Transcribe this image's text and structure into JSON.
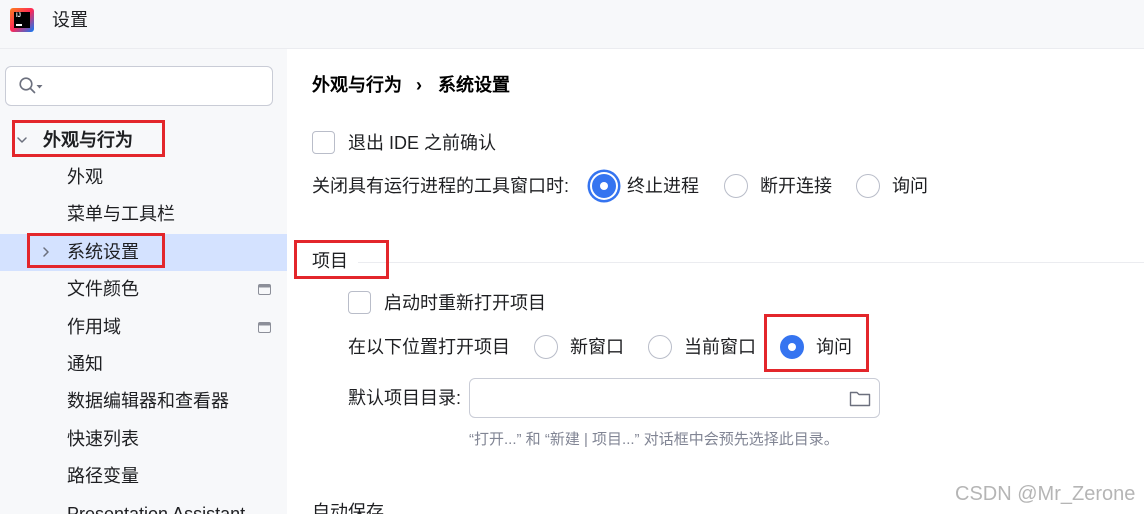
{
  "window": {
    "title": "设置",
    "logo_text": "IJ",
    "app_icon": "intellij-idea-logo-icon"
  },
  "colors": {
    "accent": "#3574f0",
    "annotation": "#e3262b",
    "selection": "#d4e2ff",
    "text": "#1e1f22",
    "hint": "#818594"
  },
  "sidebar": {
    "search": {
      "icon": "search-icon",
      "dropdown_icon": "chevron-down-icon"
    },
    "tree": [
      {
        "label": "外观与行为",
        "expanded": true,
        "icon": "chevron-down-icon",
        "children": [
          {
            "label": "外观"
          },
          {
            "label": "菜单与工具栏"
          },
          {
            "label": "系统设置",
            "selected": true,
            "expandable": true,
            "icon": "chevron-right-icon"
          },
          {
            "label": "文件颜色",
            "badge_icon": "project-level-icon"
          },
          {
            "label": "作用域",
            "badge_icon": "project-level-icon"
          },
          {
            "label": "通知"
          },
          {
            "label": "数据编辑器和查看器"
          },
          {
            "label": "快速列表"
          },
          {
            "label": "路径变量"
          },
          {
            "label": "Presentation Assistant"
          }
        ]
      }
    ]
  },
  "breadcrumb": {
    "parent": "外观与行为",
    "separator": "›",
    "current": "系统设置"
  },
  "general": {
    "confirm_exit": {
      "label": "退出 IDE 之前确认",
      "checked": false
    },
    "close_tool_window": {
      "label": "关闭具有运行进程的工具窗口时:",
      "options": [
        {
          "label": "终止进程",
          "selected": true,
          "focused": true
        },
        {
          "label": "断开连接",
          "selected": false
        },
        {
          "label": "询问",
          "selected": false
        }
      ]
    }
  },
  "project": {
    "header": "项目",
    "reopen_on_startup": {
      "label": "启动时重新打开项目",
      "checked": false
    },
    "open_location": {
      "label": "在以下位置打开项目",
      "options": [
        {
          "label": "新窗口",
          "selected": false
        },
        {
          "label": "当前窗口",
          "selected": false
        },
        {
          "label": "询问",
          "selected": true
        }
      ]
    },
    "default_directory": {
      "label": "默认项目目录:",
      "browse_icon": "folder-icon",
      "hint": "“打开...” 和 “新建 | 项目...” 对话框中会预先选择此目录。"
    }
  },
  "autosave": {
    "header": "自动保存"
  },
  "watermark": "CSDN @Mr_Zerone"
}
